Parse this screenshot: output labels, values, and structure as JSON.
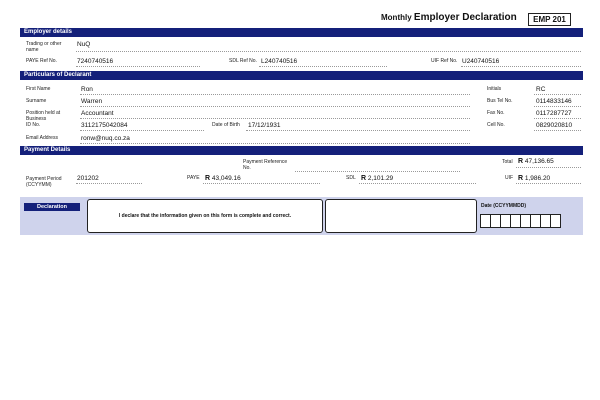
{
  "header": {
    "title_prefix": "Monthly",
    "title_main": "Employer Declaration",
    "form_code": "EMP 201"
  },
  "employer": {
    "section_title": "Employer details",
    "trading_label": "Trading or other name",
    "trading_value": "NuQ",
    "paye_label": "PAYE Ref No.",
    "paye_value": "7240740516",
    "sdl_label": "SDL Ref No.",
    "sdl_value": "L240740516",
    "uif_label": "UIF Ref No.",
    "uif_value": "U240740516"
  },
  "declarant": {
    "section_title": "Particulars of Declarant",
    "first_name_label": "First Name",
    "first_name": "Ron",
    "surname_label": "Surname",
    "surname": "Warren",
    "position_label": "Position held at Business",
    "position": "Accountant",
    "id_label": "ID No.",
    "id_no": "3112175042084",
    "dob_label": "Date of Birth",
    "dob": "17/12/1931",
    "email_label": "Email Address",
    "email": "ronw@nuq.co.za",
    "initials_label": "Initials",
    "initials": "RC",
    "bus_tel_label": "Bus Tel No.",
    "bus_tel": "0114833146",
    "fax_label": "Fax No.",
    "fax": "0117287727",
    "cell_label": "Cell No.",
    "cell": "0829020810"
  },
  "payment": {
    "section_title": "Payment Details",
    "payment_ref_label": "Payment Reference No.",
    "total_label": "Total",
    "total": "47,136.65",
    "period_label": "Payment Period (CCYYMM)",
    "period": "201202",
    "paye_label": "PAYE",
    "paye": "43,049.16",
    "sdl_label": "SDL",
    "sdl": "2,101.29",
    "uif_label": "UIF",
    "uif": "1,986.20",
    "currency": "R"
  },
  "declaration": {
    "tag": "Declaration",
    "statement": "I declare that the information given on this form is complete and correct.",
    "date_label": "Date (CCYYMMDD)"
  }
}
